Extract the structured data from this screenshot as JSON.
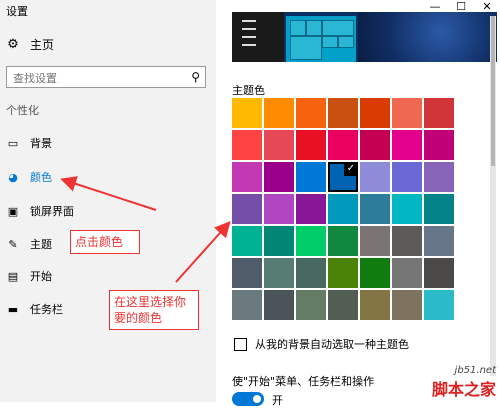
{
  "window": {
    "title": "设置"
  },
  "sidebar": {
    "home_label": "主页",
    "search_placeholder": "查找设置",
    "section_title": "个性化",
    "items": [
      {
        "label": "背景",
        "icon": "image-icon"
      },
      {
        "label": "颜色",
        "icon": "palette-icon",
        "active": true
      },
      {
        "label": "锁屏界面",
        "icon": "lock-screen-icon"
      },
      {
        "label": "主题",
        "icon": "brush-icon"
      },
      {
        "label": "开始",
        "icon": "start-icon"
      },
      {
        "label": "任务栏",
        "icon": "taskbar-icon"
      }
    ]
  },
  "main": {
    "accent_title": "主题色",
    "auto_pick_label": "从我的背景自动选取一种主题色",
    "start_setting_label": "使\"开始\"菜单、任务栏和操作",
    "toggle_label": "开",
    "accent_colors": [
      [
        "#ffb900",
        "#ff8c00",
        "#f7630c",
        "#ca5010",
        "#da3b01",
        "#ef6950",
        "#d13438"
      ],
      [
        "#ff4343",
        "#e74856",
        "#e81123",
        "#ea005e",
        "#c30052",
        "#e3008c",
        "#bf0077"
      ],
      [
        "#c239b3",
        "#9a0089",
        "#0078d7",
        "#0063b1",
        "#8e8cd8",
        "#6b69d6",
        "#8764b8"
      ],
      [
        "#744da9",
        "#b146c2",
        "#881798",
        "#0099bc",
        "#2d7d9a",
        "#00b7c3",
        "#038387"
      ],
      [
        "#00b294",
        "#018574",
        "#00cc6a",
        "#10893e",
        "#7a7574",
        "#5d5a58",
        "#68768a"
      ],
      [
        "#515c6b",
        "#567c73",
        "#486860",
        "#498205",
        "#107c10",
        "#767676",
        "#4c4a48"
      ],
      [
        "#69797e",
        "#4a5459",
        "#647c64",
        "#525e54",
        "#847545",
        "#7e735f",
        "#2bbac8"
      ]
    ],
    "selected_color": "#0063b1"
  },
  "window_controls": [
    "—",
    "☐",
    "✕"
  ],
  "annotations": {
    "click_color": "点击颜色",
    "choose_color": "在这里选择你要的颜色"
  },
  "watermark": {
    "site": "jb51.net",
    "brand": "脚本之家"
  }
}
